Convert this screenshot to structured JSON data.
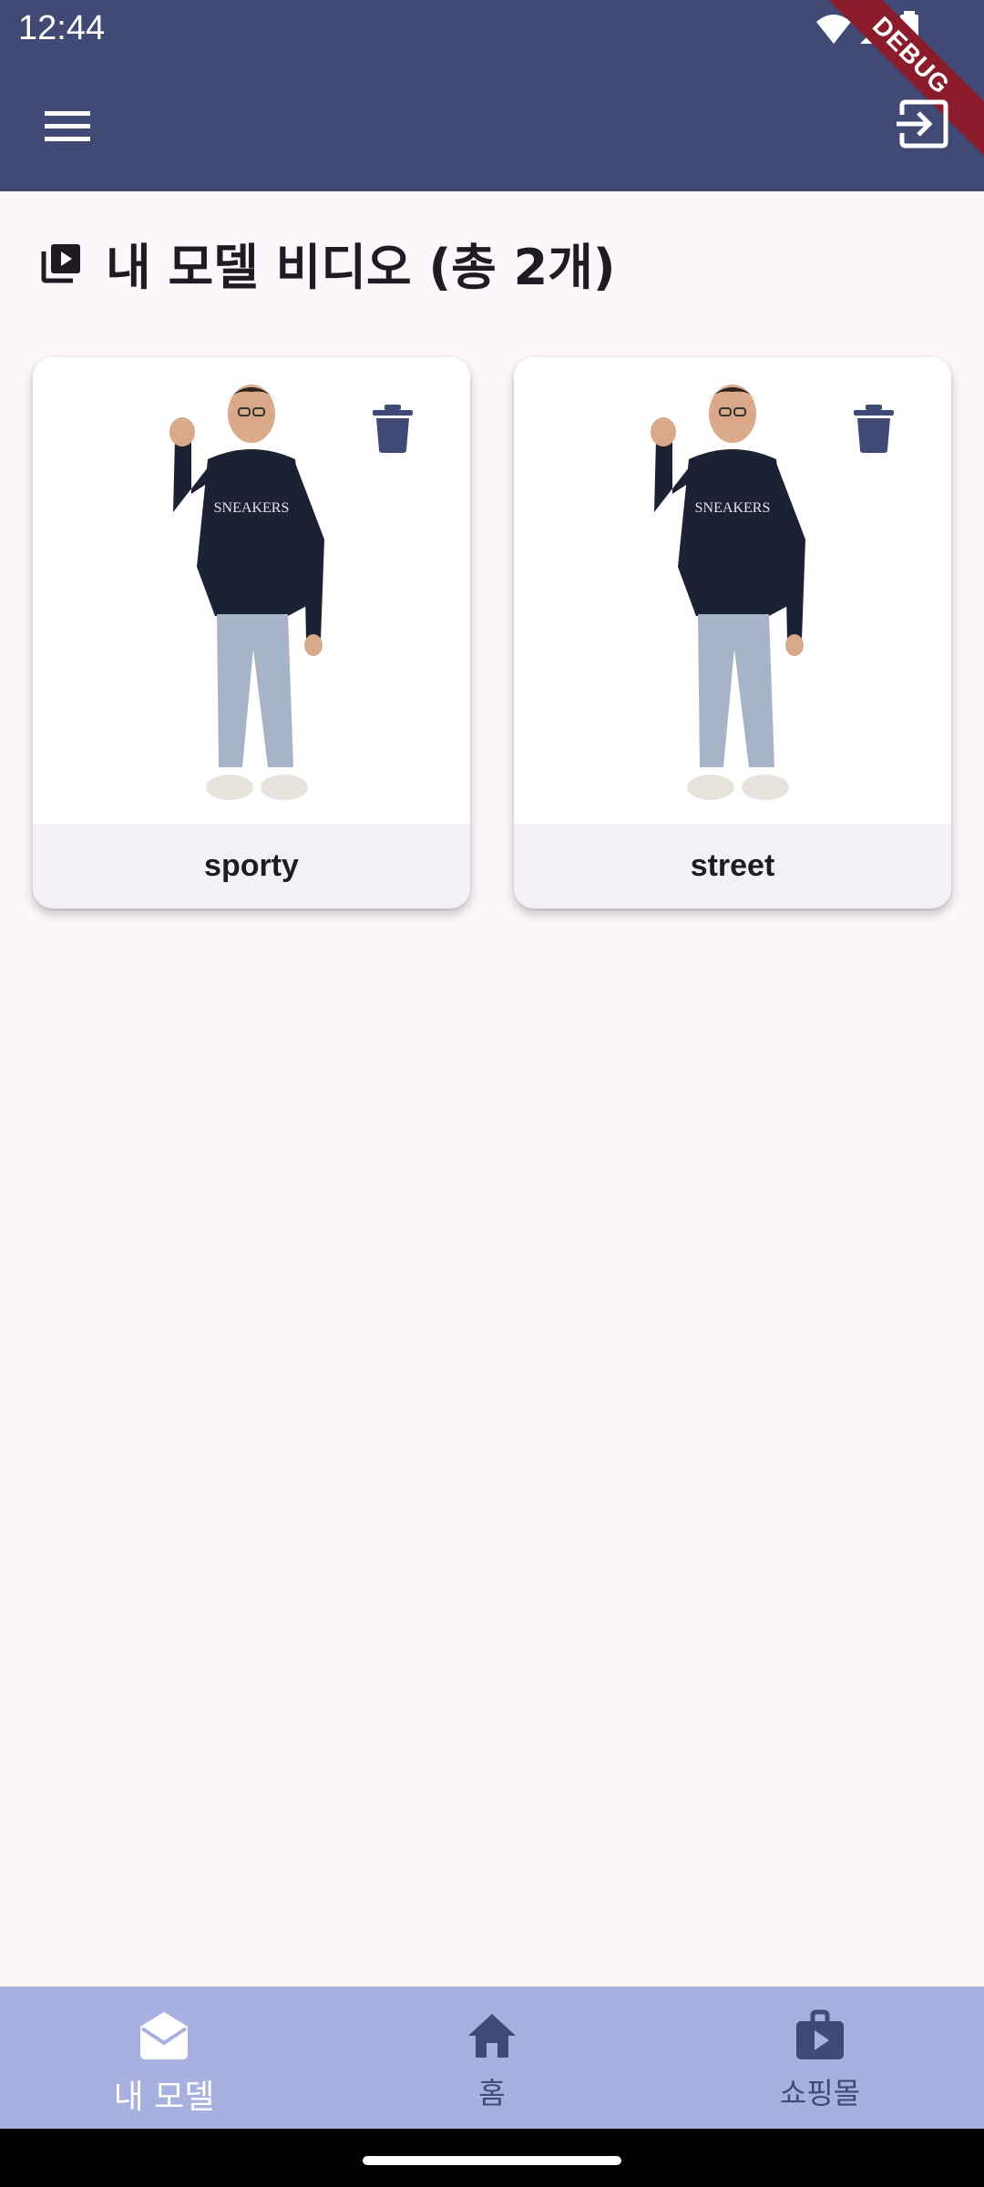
{
  "status_bar": {
    "time": "12:44"
  },
  "debug_banner": "DEBUG",
  "app_bar": {
    "menu_icon": "menu-icon",
    "logout_icon": "logout-icon"
  },
  "page": {
    "title": "내 모델 비디오 (총 2개)",
    "title_icon": "video-library-icon"
  },
  "videos": [
    {
      "label": "sporty",
      "delete_icon": "trash-icon"
    },
    {
      "label": "street",
      "delete_icon": "trash-icon"
    }
  ],
  "bottom_nav": {
    "items": [
      {
        "label": "내 모델",
        "icon": "drafts-icon",
        "active": true
      },
      {
        "label": "홈",
        "icon": "home-icon",
        "active": false
      },
      {
        "label": "쇼핑몰",
        "icon": "shopping-bag-icon",
        "active": false
      }
    ]
  },
  "colors": {
    "app_bar": "#414a74",
    "nav_bar": "#a7b0df",
    "background": "#fdf7fc",
    "icon": "#414a74"
  }
}
